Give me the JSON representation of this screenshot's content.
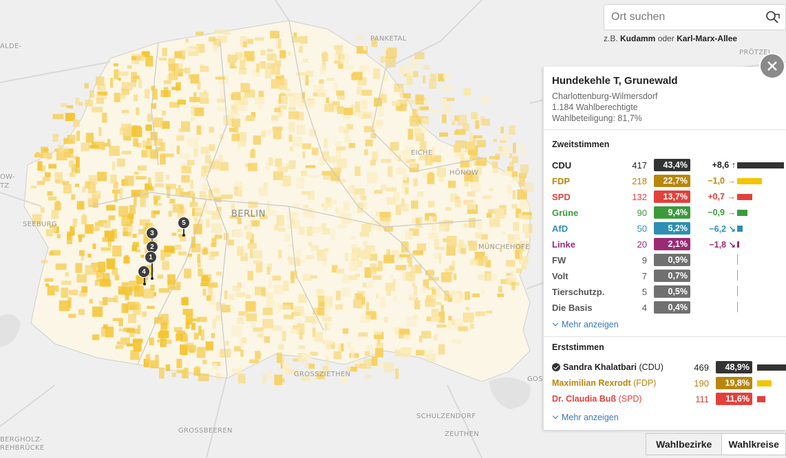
{
  "map": {
    "places": [
      {
        "id": "pankeral",
        "text": "PANKETAL"
      },
      {
        "id": "proetzel",
        "text": "PRÖTZEL"
      },
      {
        "id": "alde",
        "text": "ALDE-"
      },
      {
        "id": "eiche",
        "text": "EICHE"
      },
      {
        "id": "hoenow",
        "text": "HÖNOW"
      },
      {
        "id": "ow",
        "text": "OW-"
      },
      {
        "id": "tz",
        "text": "TZ"
      },
      {
        "id": "seeburg",
        "text": "SEEBURG"
      },
      {
        "id": "muenchehofe",
        "text": "MÜNCHEHOFE"
      },
      {
        "id": "grossziethen",
        "text": "GROSSZIETHEN"
      },
      {
        "id": "gos",
        "text": "GOS"
      },
      {
        "id": "schulzendorf",
        "text": "SCHULZENDORF"
      },
      {
        "id": "zeuthen",
        "text": "ZEUTHEN"
      },
      {
        "id": "grossbeeren",
        "text": "GROSSBEEREN"
      },
      {
        "id": "bergholz",
        "text": "BERGHOLZ-"
      },
      {
        "id": "rehbruecke",
        "text": "REHBRÜCKE"
      }
    ],
    "city_label": "BERLIN",
    "markers": [
      "1",
      "2",
      "3",
      "4",
      "5"
    ]
  },
  "search": {
    "placeholder": "Ort suchen",
    "hint_prefix": "z.B.",
    "hint_example1": "Kudamm",
    "hint_or": "oder",
    "hint_example2": "Karl-Marx-Allee"
  },
  "panel": {
    "title": "Hundekehle T, Grunewald",
    "district": "Charlottenburg-Wilmersdorf",
    "eligible": "1.184 Wahlberechtigte",
    "turnout": "Wahlbeteiligung: 81,7%",
    "second_votes_title": "Zweitstimmen",
    "second_votes": [
      {
        "party": "CDU",
        "count": "417",
        "pct": "43,4%",
        "diff": "+8,6",
        "arrow": "↑",
        "color": "#333333",
        "name_color": "#222222",
        "diff_color": "#222222",
        "share": 0.434
      },
      {
        "party": "FDP",
        "count": "218",
        "pct": "22,7%",
        "diff": "−1,0",
        "arrow": "→",
        "color": "#b8860b",
        "name_color": "#b8860b",
        "diff_color": "#b8860b",
        "bar_color": "#f5c400",
        "share": 0.227
      },
      {
        "party": "SPD",
        "count": "132",
        "pct": "13,7%",
        "diff": "+0,7",
        "arrow": "→",
        "color": "#e3403b",
        "name_color": "#e3403b",
        "diff_color": "#e3403b",
        "share": 0.137
      },
      {
        "party": "Grüne",
        "count": "90",
        "pct": "9,4%",
        "diff": "−0,9",
        "arrow": "→",
        "color": "#3c9a3c",
        "name_color": "#3c9a3c",
        "diff_color": "#3c9a3c",
        "share": 0.094
      },
      {
        "party": "AfD",
        "count": "50",
        "pct": "5,2%",
        "diff": "−6,2",
        "arrow": "↘",
        "color": "#2d8fb3",
        "name_color": "#2d8fb3",
        "diff_color": "#2d8fb3",
        "share": 0.052
      },
      {
        "party": "Linke",
        "count": "20",
        "pct": "2,1%",
        "diff": "−1,8",
        "arrow": "↘",
        "color": "#9b2a74",
        "name_color": "#9b2a74",
        "diff_color": "#9b2a74",
        "share": 0.021
      },
      {
        "party": "FW",
        "count": "9",
        "pct": "0,9%",
        "diff": "",
        "arrow": "",
        "color": "#707070",
        "name_color": "#555555",
        "diff_color": "#555555",
        "share": 0.009
      },
      {
        "party": "Volt",
        "count": "7",
        "pct": "0,7%",
        "diff": "",
        "arrow": "",
        "color": "#707070",
        "name_color": "#555555",
        "diff_color": "#555555",
        "share": 0.007
      },
      {
        "party": "Tierschutzp.",
        "count": "5",
        "pct": "0,5%",
        "diff": "",
        "arrow": "",
        "color": "#707070",
        "name_color": "#555555",
        "diff_color": "#555555",
        "share": 0.005
      },
      {
        "party": "Die Basis",
        "count": "4",
        "pct": "0,4%",
        "diff": "",
        "arrow": "",
        "color": "#707070",
        "name_color": "#555555",
        "diff_color": "#555555",
        "share": 0.004
      }
    ],
    "more_label": "Mehr anzeigen",
    "first_votes_title": "Erststimmen",
    "first_votes": [
      {
        "name": "Sandra Khalatbari",
        "party": "(CDU)",
        "count": "469",
        "pct": "48,9%",
        "color": "#333333",
        "name_color": "#222222",
        "winner": true,
        "share": 0.489
      },
      {
        "name": "Maximilian Rexrodt",
        "party": "(FDP)",
        "count": "190",
        "pct": "19,8%",
        "color": "#b8860b",
        "name_color": "#b8860b",
        "bar_color": "#f5c400",
        "winner": false,
        "share": 0.198
      },
      {
        "name": "Dr. Claudia Buß",
        "party": "(SPD)",
        "count": "111",
        "pct": "11,6%",
        "color": "#e3403b",
        "name_color": "#e3403b",
        "winner": false,
        "share": 0.116
      }
    ],
    "more_label2": "Mehr anzeigen"
  },
  "tabs": {
    "active": "Wahlbezirke",
    "inactive": "Wahlkreise"
  },
  "colors": {
    "map_background": "#efefef",
    "choropleth_high": "#f3c12f",
    "choropleth_low": "#fbe9a8",
    "accent_link": "#3b78b5"
  }
}
